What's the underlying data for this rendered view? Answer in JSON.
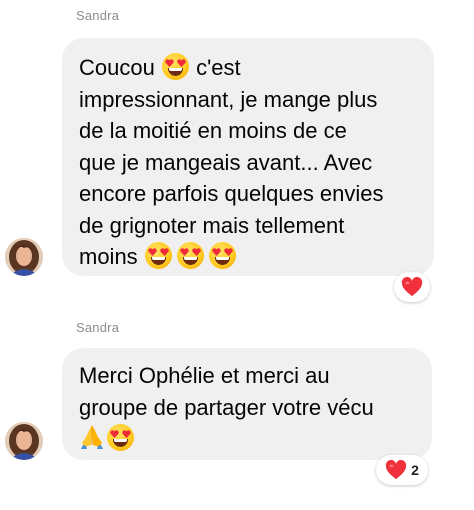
{
  "messages": [
    {
      "sender": "Sandra",
      "lines": [
        [
          "Coucou ",
          "[heart-eyes]",
          " c'est"
        ],
        [
          "impressionnant, je mange plus"
        ],
        [
          "de la moitié en moins de ce"
        ],
        [
          "que je mangeais avant... Avec"
        ],
        [
          "encore parfois quelques envies"
        ],
        [
          "de grignoter mais tellement"
        ],
        [
          "moins ",
          "[heart-eyes]",
          "[heart-eyes]",
          "[heart-eyes]"
        ]
      ],
      "text_segments": {
        "l1a": "Coucou",
        "l1b": "c'est",
        "l2": "impressionnant, je mange plus",
        "l3": "de la moitié en moins de ce",
        "l4": "que je mangeais avant... Avec",
        "l5": "encore parfois quelques envies",
        "l6": "de grignoter mais tellement",
        "l7": "moins"
      },
      "reaction": {
        "icon": "red-heart-icon",
        "count": ""
      }
    },
    {
      "sender": "Sandra",
      "text_segments": {
        "l1": "Merci Ophélie et merci au",
        "l2": "groupe de partager votre vécu"
      },
      "emojis_line3": [
        "folded-hands-icon",
        "heart-eyes-icon"
      ],
      "reaction": {
        "icon": "red-heart-icon",
        "count": "2"
      }
    }
  ],
  "colors": {
    "bubble_bg": "#f0f0f0",
    "sender_text": "#8a8d91",
    "reaction_heart": "#f0313b"
  }
}
